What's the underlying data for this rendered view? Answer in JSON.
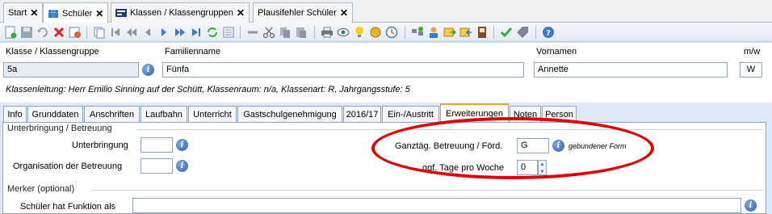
{
  "doc_tabs": [
    {
      "label": "Start",
      "icon": "none"
    },
    {
      "label": "Schüler",
      "icon": "students-icon"
    },
    {
      "label": "Klassen / Klassengruppen",
      "icon": "classes-icon"
    },
    {
      "label": "Plausifehler Schüler",
      "icon": "none"
    }
  ],
  "close_glyph": "✕",
  "header": {
    "klasse_label": "Klasse / Klassengruppe",
    "klasse_value": "5a",
    "familienname_label": "Familienname",
    "familienname_value": "Fünfa",
    "vornamen_label": "Vornamen",
    "vornamen_value": "Annette",
    "mw_label": "m/w",
    "mw_value": "W",
    "klassenleitung": "Klassenleitung: Herr Emilio Sinning auf der Schütt, Klassenraum: n/a, Klassenart: R, Jahrgangsstufe: 5"
  },
  "sub_tabs": [
    "Info",
    "Grunddaten",
    "Anschriften",
    "Laufbahn",
    "Unterricht",
    "Gastschulgenehmigung",
    "2016/17",
    "Ein-/Austritt",
    "Erweiterungen",
    "Noten",
    "Person"
  ],
  "active_sub_tab": "Erweiterungen",
  "unterbringung_section": {
    "title": "Unterbringung / Betreuung",
    "unterbringung_label": "Unterbringung",
    "unterbringung_value": "",
    "organisation_label": "Organisation der Betreuung",
    "organisation_value": "",
    "ganztag_label": "Ganztäg. Betreuung / Förd.",
    "ganztag_value": "G",
    "ganztag_hint": "gebundener Form",
    "tage_label": "ggf. Tage pro Woche",
    "tage_value": "0"
  },
  "merker_section": {
    "title": "Merker (optional)",
    "funktion_label": "Schüler hat Funktion als",
    "funktion_value": ""
  },
  "info_glyph": "i",
  "colors": {
    "highlight_ellipse": "#e00000",
    "active_tab_accent": "#f0a030",
    "field_border": "#8ea4c1",
    "background": "#dfe8f6"
  }
}
